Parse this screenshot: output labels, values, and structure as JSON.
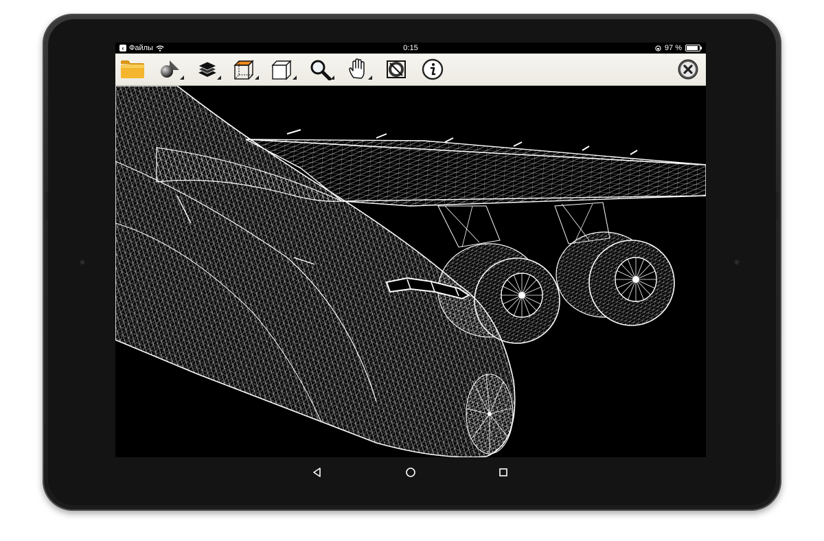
{
  "status_bar": {
    "back_label": "Файлы",
    "time": "0:15",
    "battery": "97 %",
    "battery_level": 0.97
  },
  "toolbar": {
    "tools": [
      {
        "name": "open-file-button",
        "icon": "folder-icon"
      },
      {
        "name": "shading-button",
        "icon": "shapes-icon"
      },
      {
        "name": "layers-button",
        "icon": "layers-icon"
      },
      {
        "name": "view-cube-button",
        "icon": "cube-orange-face-icon"
      },
      {
        "name": "projection-button",
        "icon": "cube-icon"
      },
      {
        "name": "zoom-button",
        "icon": "magnifier-icon"
      },
      {
        "name": "pan-button",
        "icon": "hand-icon"
      },
      {
        "name": "fit-view-button",
        "icon": "fit-view-icon"
      },
      {
        "name": "info-button",
        "icon": "info-icon"
      }
    ],
    "close_icon": "close-icon"
  },
  "viewport": {
    "render_mode": "wireframe",
    "background": "#000000",
    "wire_color": "#ffffff"
  },
  "colors": {
    "toolbar_bg": "#efede6",
    "folder": "#f0b428",
    "accent_orange": "#f08a1c"
  }
}
